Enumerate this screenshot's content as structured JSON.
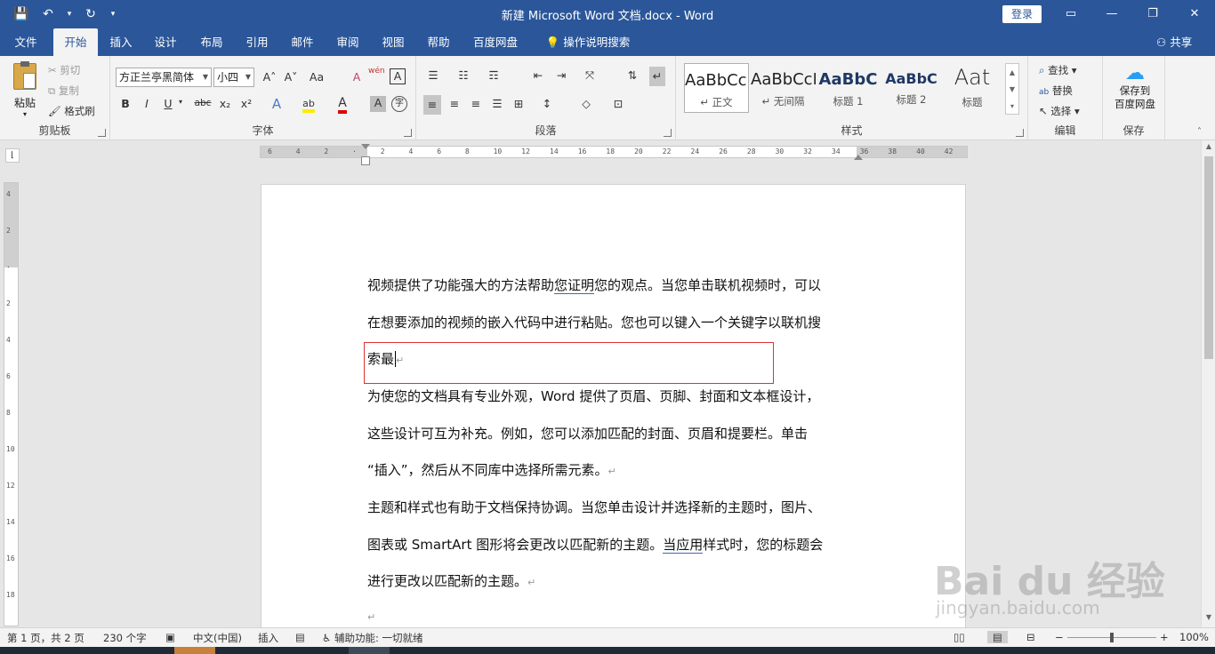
{
  "window": {
    "title": "新建 Microsoft Word 文档.docx  -  Word",
    "login": "登录",
    "minimize": "—",
    "restore": "❐",
    "close": "✕"
  },
  "qat": {
    "save": "💾",
    "undo": "↶",
    "undo_more": "▾",
    "redo": "↻",
    "customize": "▾"
  },
  "tabs": [
    "文件",
    "开始",
    "插入",
    "设计",
    "布局",
    "引用",
    "邮件",
    "审阅",
    "视图",
    "帮助",
    "百度网盘",
    "操作说明搜索"
  ],
  "share": "共享",
  "ribbon": {
    "clipboard": {
      "label": "剪贴板",
      "paste": "粘贴",
      "cut": "剪切",
      "copy": "复制",
      "painter": "格式刷"
    },
    "font": {
      "label": "字体",
      "name": "方正兰亭黑简体",
      "size": "小四",
      "grow": "A˄",
      "shrink": "A˅",
      "case": "Aa",
      "clear": "A",
      "phonetic": "wén",
      "border": "A",
      "bold": "B",
      "italic": "I",
      "underline": "U",
      "strike": "abc",
      "sub": "x₂",
      "sup": "x²",
      "effects": "A",
      "highlight": "ab",
      "color": "A",
      "shade": "A",
      "enclose": "字"
    },
    "paragraph": {
      "label": "段落"
    },
    "styles": {
      "label": "样式",
      "items": [
        {
          "sample": "AaBbCcI",
          "name": "↵ 正文"
        },
        {
          "sample": "AaBbCcI",
          "name": "↵ 无间隔"
        },
        {
          "sample": "AaBbC",
          "name": "标题 1"
        },
        {
          "sample": "AaBbC",
          "name": "标题 2"
        },
        {
          "sample": "Aat",
          "name": "标题"
        }
      ]
    },
    "editing": {
      "label": "编辑",
      "find": "查找",
      "replace": "替换",
      "select": "选择"
    },
    "save": {
      "label": "保存",
      "button": "保存到\n百度网盘"
    }
  },
  "ruler": {
    "ticks": [
      "6",
      "4",
      "2",
      "",
      "2",
      "4",
      "6",
      "8",
      "10",
      "12",
      "14",
      "16",
      "18",
      "20",
      "22",
      "24",
      "26",
      "28",
      "30",
      "32",
      "34",
      "36",
      "38",
      "40",
      "42"
    ]
  },
  "vruler": {
    "ticks": [
      "4",
      "2",
      "",
      "2",
      "4",
      "6",
      "8",
      "10",
      "12",
      "14",
      "16",
      "18"
    ]
  },
  "document": {
    "p1a": "视频提供了功能强大的方法帮助",
    "p1u": "您证明",
    "p1b": "您的观点。当您单击联机视频时，可以",
    "p1c": "在想要添加的视频的嵌入代码中进行粘贴。您也可以键入一个关键字以联机搜",
    "p1d": "索最",
    "p2a": "为使您的文档具有专业外观，Word 提供了页眉、页脚、封面和文本框设计，",
    "p2b": "这些设计可互为补充。例如，您可以添加匹配的封面、页眉和提要栏。单击",
    "p2c": "“插入”，然后从不同库中选择所需元素。",
    "p3a": "主题和样式也有助于文档保持协调。当您单击设计并选择新的主题时，图片、",
    "p3b1": "图表或 SmartArt 图形将会更改以匹配新的主题。",
    "p3u": "当应用",
    "p3b2": "样式时，您的标题会",
    "p3c": "进行更改以匹配新的主题。",
    "mark": "↵"
  },
  "status": {
    "page": "第 1 页，共 2 页",
    "words": "230 个字",
    "lang": "中文(中国)",
    "mode": "插入",
    "access": "辅助功能: 一切就绪",
    "zoom": "100%",
    "minus": "−",
    "plus": "+"
  },
  "watermark": {
    "logo": "Bai du 经验",
    "sub": "jingyan.baidu.com"
  },
  "colors": {
    "brand": "#2b579a",
    "ribbon": "#f3f3f3",
    "canvas": "#e6e6e6"
  }
}
